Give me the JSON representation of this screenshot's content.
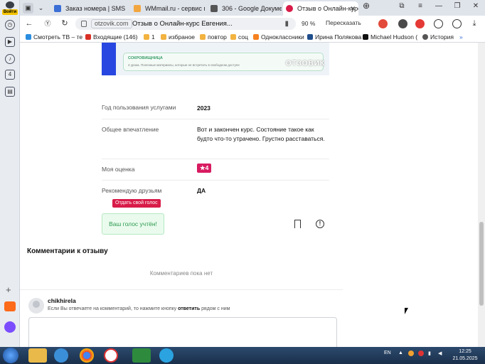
{
  "sidebar": {
    "user_label": "Войти"
  },
  "tabs": [
    {
      "label": "Заказ номера | SMS-Ac",
      "fav_color": "#3b6fd6"
    },
    {
      "label": "WMmail.ru - сервис по",
      "fav_color": "#f2a640"
    },
    {
      "label": "306 - Google Документ",
      "fav_color": "#555555"
    },
    {
      "label": "Отзыв о Онлайн-курс",
      "fav_color": "#d81b48"
    }
  ],
  "address": {
    "domain": "otzovik.com",
    "title": "Отзыв о Онлайн-курс Евгения...",
    "zoom": "90 %",
    "translate": "Пересказать"
  },
  "bookmarks": [
    {
      "label": "Смотреть ТВ – те",
      "color": "#2a8de0"
    },
    {
      "label": "Входящие (146)",
      "color": "#d93025"
    },
    {
      "label": "1",
      "color": "#f3b340"
    },
    {
      "label": "избраное",
      "color": "#f3b340"
    },
    {
      "label": "повтор",
      "color": "#f3b340"
    },
    {
      "label": "соц",
      "color": "#f3b340"
    },
    {
      "label": "Одноклассники",
      "color": "#f5811f"
    },
    {
      "label": "Ирина Полякова",
      "color": "#1f4d8c"
    },
    {
      "label": "Michael Hudson (",
      "color": "#111111"
    },
    {
      "label": "История",
      "color": "#555555"
    }
  ],
  "banner": {
    "card_heading": "СОКРОВИЩНИЦА",
    "card_sub": "4 урока. Полезные материалы, которые не встретить в свободном доступе",
    "watermark": "ОТЗОВИК"
  },
  "review": {
    "year_label": "Год пользования услугами",
    "year_value": "2023",
    "impression_label": "Общее впечатление",
    "impression_value": "Вот и закончен курс. Состояние такое как будто что-то утрачено. Грустно расставаться.",
    "rating_label": "Моя оценка",
    "rating_value": "4",
    "recommend_label": "Рекомендую друзьям",
    "recommend_value": "ДА"
  },
  "vote": {
    "tooltip": "Отдать свой голос",
    "voted_text": "Ваш голос учтён!"
  },
  "comments": {
    "heading": "Комментарии к отзыву",
    "empty_text": "Комментариев пока нет",
    "username": "chikhirela",
    "hint_pre": "Если Вы отвечаете на комментарий, то нажмите кнопку ",
    "hint_bold": "ответить",
    "hint_post": " рядом с ним"
  },
  "taskbar": {
    "lang": "EN",
    "time": "12:25",
    "date": "21.05.2025"
  }
}
